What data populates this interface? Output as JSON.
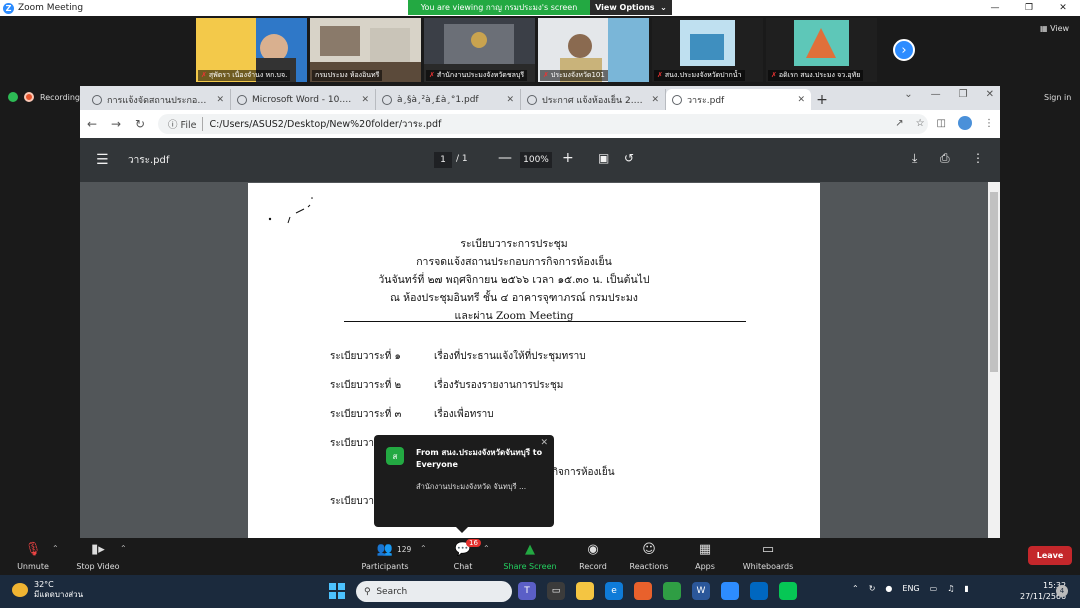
{
  "zoom": {
    "window_title": "Zoom Meeting",
    "share_banner": "You are viewing กาญ กรมประมง's screen",
    "view_options": "View Options",
    "view_label": "View"
  },
  "participants_strip": [
    {
      "name": "สุพัตรา เนื่องจำนง หก.บจ."
    },
    {
      "name": "กรมประมง ห้องอินทรี"
    },
    {
      "name": "สำนักงานประมงจังหวัดชลบุรี"
    },
    {
      "name": "ประมงจังหวัด101"
    },
    {
      "name": "สนง.ประมงจังหวัดปากน้ำ"
    },
    {
      "name": "อดิเรก สนง.ประมง จว.อุทัย"
    }
  ],
  "recording_label": "Recording",
  "browser": {
    "tabs": [
      {
        "label": "การแจ้งจัดสถานประกอบการกิ"
      },
      {
        "label": "Microsoft Word - 10.doc"
      },
      {
        "label": "à¸§à¸²à¸£à¸°1.pdf"
      },
      {
        "label": "ประกาศ แจ้งห้องเย็น 2.pdf"
      },
      {
        "label": "วาระ.pdf"
      }
    ],
    "file_label": "File",
    "url": "C:/Users/ASUS2/Desktop/New%20folder/วาระ.pdf",
    "sign_in": "Sign in"
  },
  "pdf": {
    "filename": "วาระ.pdf",
    "page_current": "1",
    "page_total": "/ 1",
    "zoom": "100%",
    "header_lines": [
      "ระเบียบวาระการประชุม",
      "การจดแจ้งสถานประกอบการกิจการห้องเย็น",
      "วันจันทร์ที่ ๒๗ พฤศจิกายน ๒๕๖๖ เวลา ๑๕.๓๐ น. เป็นต้นไป",
      "ณ ห้องประชุมอินทรี ชั้น ๔ อาคารจุฑาภรณ์ กรมประมง",
      "และผ่าน Zoom Meeting"
    ],
    "agenda": [
      {
        "num": "ระเบียบวาระที่ ๑",
        "text": "เรื่องที่ประธานแจ้งให้ที่ประชุมทราบ"
      },
      {
        "num": "ระเบียบวาระที่ ๒",
        "text": "เรื่องรับรองรายงานการประชุม"
      },
      {
        "num": "ระเบียบวาระที่ ๓",
        "text": "เรื่องเพื่อทราบ"
      },
      {
        "num": "ระเบียบวา",
        "text": ""
      },
      {
        "num": "",
        "text": "กิจการห้องเย็น"
      },
      {
        "num": "ระเบียบวา",
        "text": ""
      }
    ]
  },
  "chat_popup": {
    "icon_letter": "ส",
    "from": "From สนง.ประมงจังหวัดจันทบุรี to Everyone",
    "message": "สำนักงานประมงจังหวัด จันทบุรี ..."
  },
  "zoom_bar": {
    "unmute": "Unmute",
    "stop_video": "Stop Video",
    "participants": "Participants",
    "participants_count": "129",
    "chat": "Chat",
    "chat_badge": "16",
    "share_screen": "Share Screen",
    "record": "Record",
    "reactions": "Reactions",
    "apps": "Apps",
    "whiteboards": "Whiteboards",
    "leave": "Leave"
  },
  "taskbar": {
    "temp": "32°C",
    "weather_text": "มีแดดบางส่วน",
    "search": "Search",
    "lang": "ENG",
    "time": "15:32",
    "date": "27/11/2566",
    "notif_count": "4"
  }
}
